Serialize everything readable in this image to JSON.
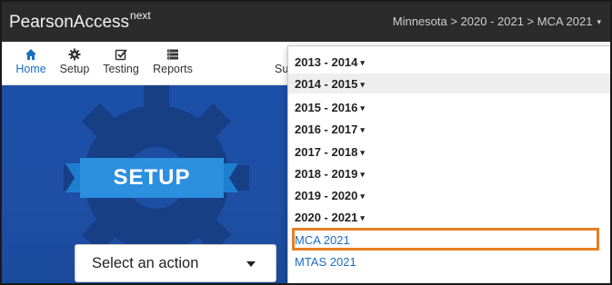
{
  "header": {
    "brand": "PearsonAccess",
    "brand_sup": "next",
    "context": "Minnesota > 2020 - 2021 > MCA 2021",
    "context_caret": "▾"
  },
  "nav": {
    "home": {
      "label": "Home",
      "icon": "home-icon"
    },
    "setup": {
      "label": "Setup",
      "icon": "gear-icon"
    },
    "testing": {
      "label": "Testing",
      "icon": "checkbox-icon"
    },
    "reports": {
      "label": "Reports",
      "icon": "list-icon"
    },
    "support": {
      "label": "Su"
    }
  },
  "hero": {
    "title": "SETUP",
    "select_label": "Select an action"
  },
  "dropdown": {
    "caret": "▾",
    "years": [
      "2013 - 2014",
      "2014 - 2015",
      "2015 - 2016",
      "2016 - 2017",
      "2017 - 2018",
      "2018 - 2019",
      "2019 - 2020",
      "2020 - 2021"
    ],
    "admins": [
      "MCA 2021",
      "MTAS 2021"
    ],
    "hovered_year": "2014 - 2015",
    "selected_admin": "MCA 2021"
  },
  "colors": {
    "topbar": "#2b2b2b",
    "accent_blue": "#1a6ec2",
    "hero_blue": "#1e4fa4",
    "highlight_orange": "#e67e22"
  }
}
